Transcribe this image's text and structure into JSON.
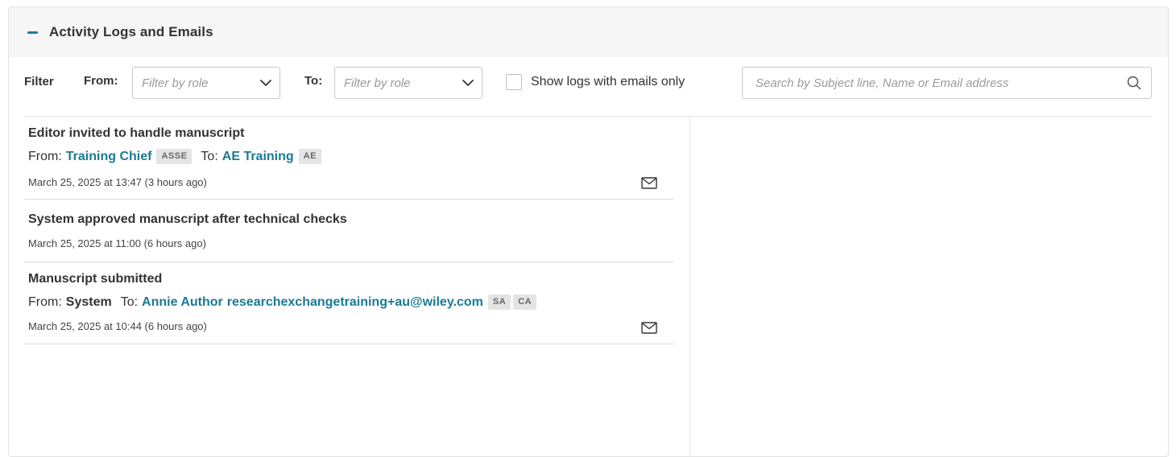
{
  "panel": {
    "title": "Activity Logs and Emails"
  },
  "filters": {
    "filter_label": "Filter",
    "from_label": "From",
    "from_colon": ":",
    "from_placeholder": "Filter by role",
    "to_label": "To",
    "to_colon": ":",
    "to_placeholder": "Filter by role",
    "emails_only_label": "Show logs with emails only",
    "search_placeholder": "Search by Subject line, Name or Email address",
    "search_value": ""
  },
  "logs": [
    {
      "title": "Editor invited to handle manuscript",
      "from_prefix": "From:",
      "from_name": "Training Chief",
      "from_badges": [
        "ASSE"
      ],
      "to_prefix": "To:",
      "to_name": "AE Training",
      "to_badges": [
        "AE"
      ],
      "timestamp": "March 25, 2025 at 13:47 (3 hours ago)",
      "icon": "mail-icon"
    },
    {
      "title": "System approved manuscript after technical checks",
      "timestamp": "March 25, 2025 at 11:00 (6 hours ago)"
    },
    {
      "title": "Manuscript submitted",
      "from_prefix": "From:",
      "from_name": "System",
      "to_prefix": "To:",
      "to_name": "Annie Author",
      "to_email": "researchexchangetraining+au@wiley.com",
      "to_badges": [
        "SA",
        "CA"
      ],
      "timestamp": "March 25, 2025 at 10:44 (6 hours ago)",
      "icon": "mail-icon"
    }
  ],
  "colors": {
    "accent": "#1a7a93",
    "header_bg": "#f6f6f6",
    "badge_bg": "#e4e4e4"
  }
}
